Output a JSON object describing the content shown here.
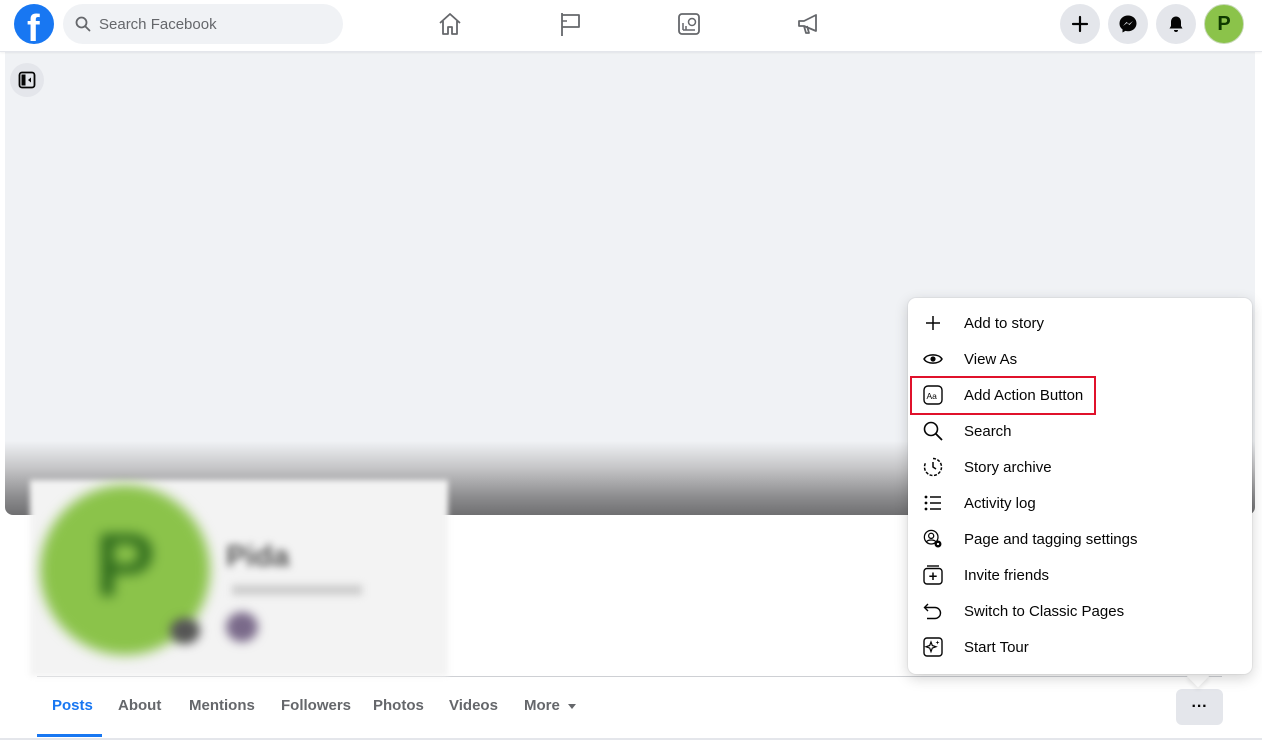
{
  "header": {
    "logo_letter": "f",
    "search_placeholder": "Search Facebook",
    "nav_icons": [
      "home-icon",
      "flag-icon",
      "insights-icon",
      "megaphone-icon"
    ],
    "action_icons": [
      "plus-icon",
      "messenger-icon",
      "bell-icon"
    ],
    "avatar_letter": "P"
  },
  "profile": {
    "name": "Pida"
  },
  "tabs": [
    {
      "label": "Posts",
      "active": true
    },
    {
      "label": "About"
    },
    {
      "label": "Mentions"
    },
    {
      "label": "Followers"
    },
    {
      "label": "Photos"
    },
    {
      "label": "Videos"
    },
    {
      "label": "More"
    }
  ],
  "more_options_label": "···",
  "menu": {
    "items": [
      {
        "label": "Add to story",
        "icon": "plus-icon"
      },
      {
        "label": "View As",
        "icon": "eye-icon"
      },
      {
        "label": "Add Action Button",
        "icon": "text-box-icon",
        "highlighted": true
      },
      {
        "label": "Search",
        "icon": "search-icon"
      },
      {
        "label": "Story archive",
        "icon": "clock-icon"
      },
      {
        "label": "Activity log",
        "icon": "list-icon"
      },
      {
        "label": "Page and tagging settings",
        "icon": "user-settings-icon"
      },
      {
        "label": "Invite friends",
        "icon": "invite-icon"
      },
      {
        "label": "Switch to Classic Pages",
        "icon": "undo-icon"
      },
      {
        "label": "Start Tour",
        "icon": "tour-icon"
      }
    ]
  },
  "colors": {
    "brand": "#1877f2",
    "highlight": "#e0112b",
    "avatar": "#8bc34a"
  }
}
